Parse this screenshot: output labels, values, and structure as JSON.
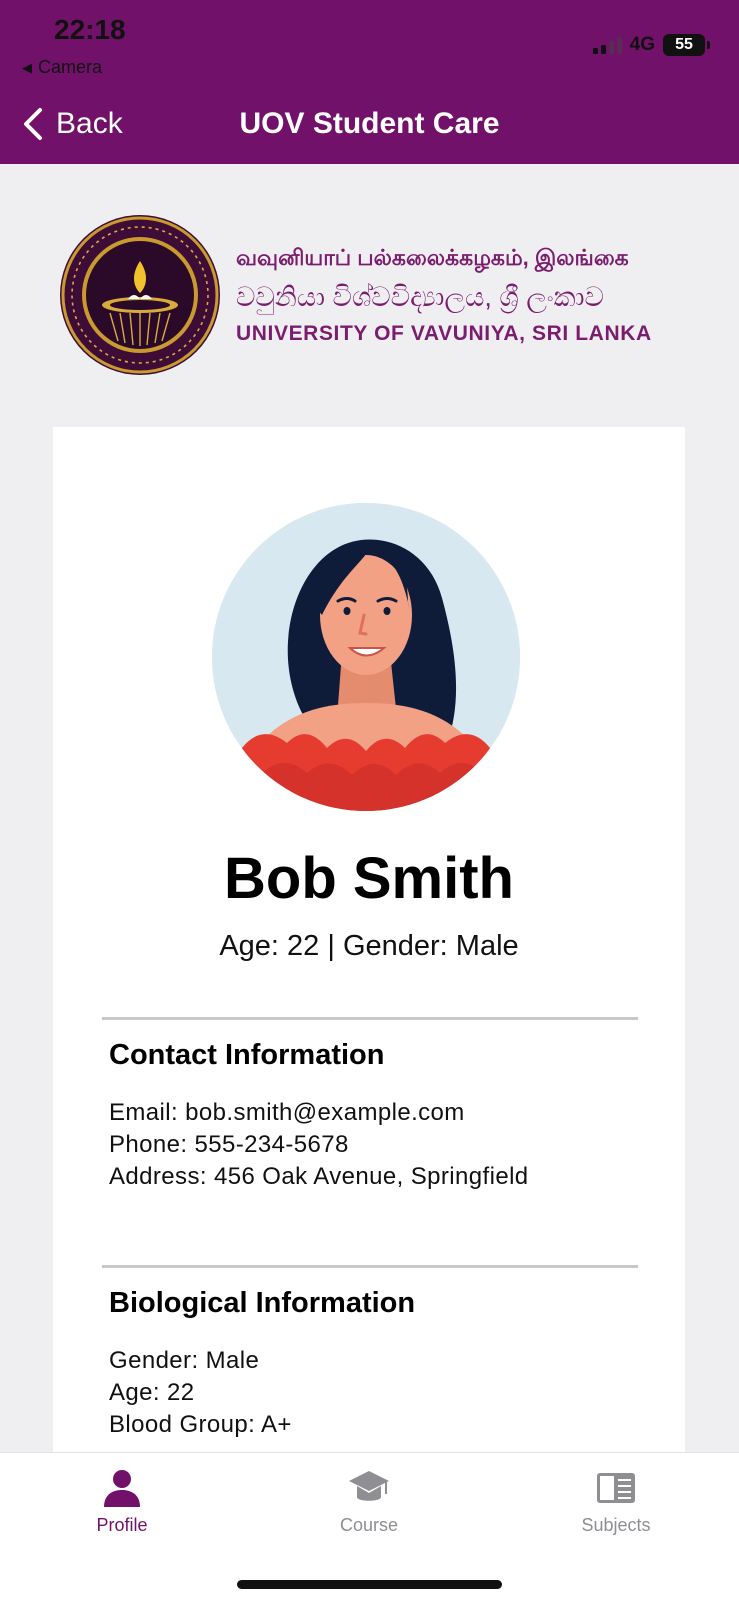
{
  "status_bar": {
    "time": "22:18",
    "back_app": "Camera",
    "network": "4G",
    "battery": "55"
  },
  "nav": {
    "back_label": "Back",
    "title": "UOV Student Care"
  },
  "logo": {
    "line1": "வவுனியாப் பல்கலைக்கழகம், இலங்கை",
    "line2": "වවුනියා විශ්වවිද්‍යාලය, ශ්‍රී ලංකාව",
    "line3": "UNIVERSITY OF VAVUNIYA, SRI LANKA"
  },
  "profile": {
    "name": "Bob Smith",
    "subline": "Age: 22 | Gender: Male"
  },
  "contact": {
    "title": "Contact Information",
    "email": "Email: bob.smith@example.com",
    "phone": "Phone: 555-234-5678",
    "address": "Address: 456 Oak Avenue, Springfield"
  },
  "biological": {
    "title": "Biological Information",
    "gender": "Gender: Male",
    "age": "Age: 22",
    "blood_group": "Blood Group: A+"
  },
  "tabs": [
    {
      "label": "Profile",
      "icon": "person-icon",
      "active": true
    },
    {
      "label": "Course",
      "icon": "graduation-cap-icon",
      "active": false
    },
    {
      "label": "Subjects",
      "icon": "book-icon",
      "active": false
    }
  ],
  "colors": {
    "brand": "#721169",
    "background": "#efeff1",
    "inactive_tab": "#8e8e93"
  }
}
